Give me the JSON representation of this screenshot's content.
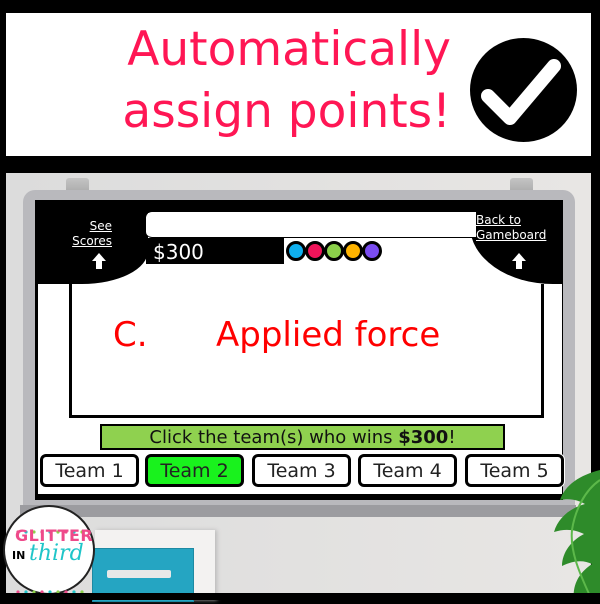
{
  "banner": {
    "headline_line1": "Automatically",
    "headline_line2": "assign points!",
    "headline_color": "#ff1654",
    "badge_icon": "checkmark-icon"
  },
  "game": {
    "nav": {
      "see_scores_line1": "See",
      "see_scores_line2": "Scores",
      "see_scores_icon": "arrow-up-icon",
      "back_line1": "Back to",
      "back_line2": "Gameboard",
      "back_icon": "arrow-up-icon"
    },
    "category_title": "",
    "point_value": "$300",
    "team_color_dots": [
      "#0fb0f0",
      "#f0145a",
      "#8bd04a",
      "#ffb400",
      "#7a4cf0"
    ],
    "answer": {
      "letter": "C.",
      "text": "Applied force",
      "color": "#ff0000"
    },
    "instruction": {
      "prefix": "Click the team(s) who wins ",
      "amount": "$300",
      "suffix": "!",
      "background": "#8fd14f"
    },
    "teams": [
      {
        "label": "Team 1",
        "selected": false
      },
      {
        "label": "Team 2",
        "selected": true
      },
      {
        "label": "Team 3",
        "selected": false
      },
      {
        "label": "Team 4",
        "selected": false
      },
      {
        "label": "Team 5",
        "selected": false
      }
    ],
    "selected_color": "#19f21d"
  },
  "logo": {
    "line1": "GLITTER",
    "line2_a": "IN",
    "line2_b": "third"
  }
}
